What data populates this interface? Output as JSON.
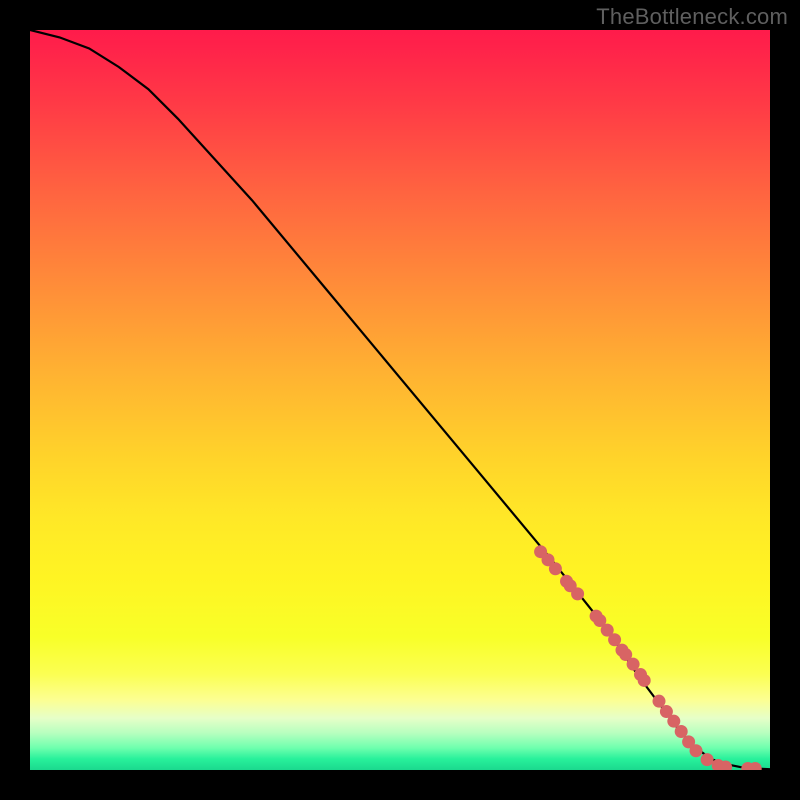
{
  "watermark": "TheBottleneck.com",
  "chart_data": {
    "type": "line",
    "title": "",
    "xlabel": "",
    "ylabel": "",
    "xlim": [
      0,
      100
    ],
    "ylim": [
      0,
      100
    ],
    "grid": false,
    "legend": false,
    "series": [
      {
        "name": "curve",
        "x": [
          0,
          4,
          8,
          12,
          16,
          20,
          30,
          40,
          50,
          60,
          70,
          78,
          82,
          85,
          88,
          90,
          92,
          94,
          96,
          98,
          100
        ],
        "y": [
          100,
          99,
          97.5,
          95,
          92,
          88,
          77,
          65,
          53,
          41,
          29,
          19,
          13,
          9,
          5,
          3,
          1.5,
          0.8,
          0.4,
          0.2,
          0.1
        ]
      }
    ],
    "highlight_points": {
      "name": "dots",
      "x": [
        69,
        70,
        71,
        72.5,
        73,
        74,
        76.5,
        77,
        78,
        79,
        80,
        80.5,
        81.5,
        82.5,
        83,
        85,
        86,
        87,
        88,
        89,
        90,
        91.5,
        93,
        94,
        97,
        98
      ],
      "y": [
        29.5,
        28.4,
        27.2,
        25.5,
        24.9,
        23.8,
        20.8,
        20.2,
        18.9,
        17.6,
        16.2,
        15.6,
        14.3,
        12.9,
        12.1,
        9.3,
        7.9,
        6.6,
        5.2,
        3.8,
        2.6,
        1.4,
        0.6,
        0.4,
        0.2,
        0.2
      ]
    },
    "background_gradient": {
      "top": "#ff1b4b",
      "mid": "#ffd42a",
      "bottom": "#1bd98e"
    }
  }
}
